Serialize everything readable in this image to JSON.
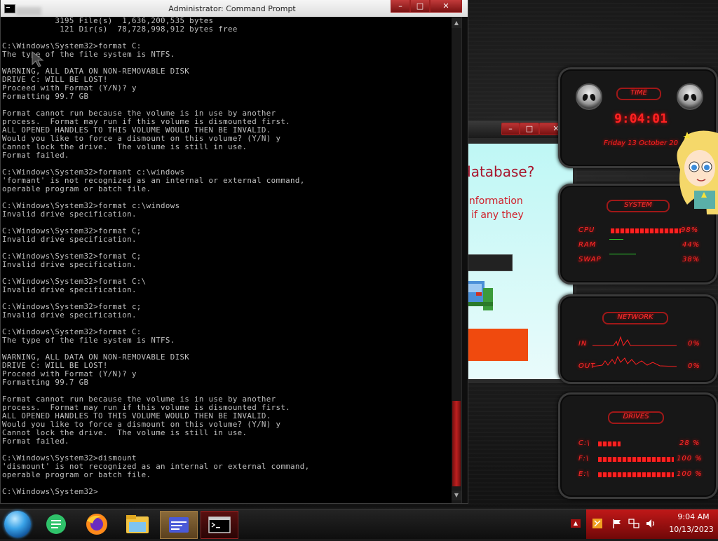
{
  "cmd": {
    "title": "Administrator: Command Prompt",
    "controls": {
      "minimize": "–",
      "maximize": "□",
      "close": "✕"
    },
    "lines": [
      "           3195 File(s)  1,636,200,535 bytes",
      "            121 Dir(s)  78,728,998,912 bytes free",
      "",
      "C:\\Windows\\System32>format C:",
      "The type of the file system is NTFS.",
      "",
      "WARNING, ALL DATA ON NON-REMOVABLE DISK",
      "DRIVE C: WILL BE LOST!",
      "Proceed with Format (Y/N)? y",
      "Formatting 99.7 GB",
      "",
      "Format cannot run because the volume is in use by another",
      "process.  Format may run if this volume is dismounted first.",
      "ALL OPENED HANDLES TO THIS VOLUME WOULD THEN BE INVALID.",
      "Would you like to force a dismount on this volume? (Y/N) y",
      "Cannot lock the drive.  The volume is still in use.",
      "Format failed.",
      "",
      "C:\\Windows\\System32>formant c:\\windows",
      "'formant' is not recognized as an internal or external command,",
      "operable program or batch file.",
      "",
      "C:\\Windows\\System32>format c:\\windows",
      "Invalid drive specification.",
      "",
      "C:\\Windows\\System32>format C;",
      "Invalid drive specification.",
      "",
      "C:\\Windows\\System32>format C;",
      "Invalid drive specification.",
      "",
      "C:\\Windows\\System32>format C:\\",
      "Invalid drive specification.",
      "",
      "C:\\Windows\\System32>format c;",
      "Invalid drive specification.",
      "",
      "C:\\Windows\\System32>format C:",
      "The type of the file system is NTFS.",
      "",
      "WARNING, ALL DATA ON NON-REMOVABLE DISK",
      "DRIVE C: WILL BE LOST!",
      "Proceed with Format (Y/N)? y",
      "Formatting 99.7 GB",
      "",
      "Format cannot run because the volume is in use by another",
      "process.  Format may run if this volume is dismounted first.",
      "ALL OPENED HANDLES TO THIS VOLUME WOULD THEN BE INVALID.",
      "Would you like to force a dismount on this volume? (Y/N) y",
      "Cannot lock the drive.  The volume is still in use.",
      "Format failed.",
      "",
      "C:\\Windows\\System32>dismount",
      "'dismount' is not recognized as an internal or external command,",
      "operable program or batch file.",
      "",
      "C:\\Windows\\System32>"
    ]
  },
  "back_window": {
    "heading": "database?",
    "line1": "information",
    "line2": "e if any they",
    "controls": {
      "minimize": "–",
      "maximize": "□",
      "close": "✕"
    }
  },
  "gadgets": {
    "time": {
      "title": "TIME",
      "clock": "9:04:01",
      "date": "Friday 13 October 20"
    },
    "system": {
      "title": "SYSTEM",
      "cpu_label": "CPU",
      "cpu_value": "98%",
      "ram_label": "RAM",
      "ram_value": "44%",
      "swap_label": "SWAP",
      "swap_value": "38%"
    },
    "network": {
      "title": "NETWORK",
      "in_label": "IN",
      "in_value": "0%",
      "out_label": "OUT",
      "out_value": "0%"
    },
    "drives": {
      "title": "DRIVES",
      "c_label": "C:\\",
      "c_value": "28 %",
      "f_label": "F:\\",
      "f_value": "100 %",
      "e_label": "E:\\",
      "e_value": "100 %"
    }
  },
  "taskbar": {
    "clock_time": "9:04 AM",
    "clock_date": "10/13/2023",
    "expand_label": "▲"
  },
  "colors": {
    "accent_red": "#ff2222",
    "console_text": "#c0c0c0",
    "tray_red": "#b01414"
  }
}
